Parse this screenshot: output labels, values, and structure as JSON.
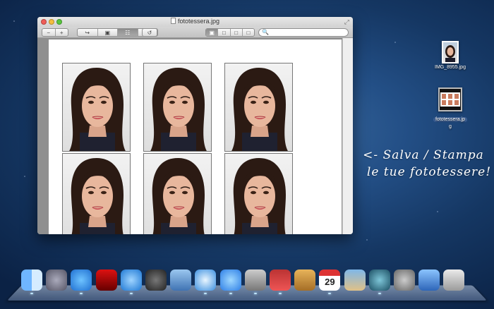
{
  "window": {
    "title": "fototessera.jpg"
  },
  "toolbar": {
    "zoom_out": "−",
    "zoom_in": "+",
    "share": "↪",
    "view": "▣",
    "grid": "☷",
    "edit": "✎",
    "rotate": "↺",
    "search_placeholder": ""
  },
  "desktop": {
    "icons": [
      {
        "label": "IMG_8955.jpg",
        "selected": false
      },
      {
        "label": "fototessera.jp",
        "selected": true,
        "sublabel": "g"
      }
    ]
  },
  "annotation": {
    "line1": "<- Salva / Stampa",
    "line2": "le tue fototessere!"
  },
  "photo_count": 6,
  "dock": {
    "icons": [
      "finder-icon",
      "launchpad-icon",
      "app-store-icon",
      "photo-booth-icon",
      "itunes-icon",
      "dashboard-icon",
      "mail-icon",
      "safari-icon",
      "messages-icon",
      "facetime-icon",
      "photo-app-icon",
      "contacts-icon",
      "calendar-icon",
      "iphoto-icon",
      "time-machine-icon",
      "system-preferences-icon",
      "xcode-icon",
      "trash-icon"
    ],
    "calendar_day": "29"
  }
}
